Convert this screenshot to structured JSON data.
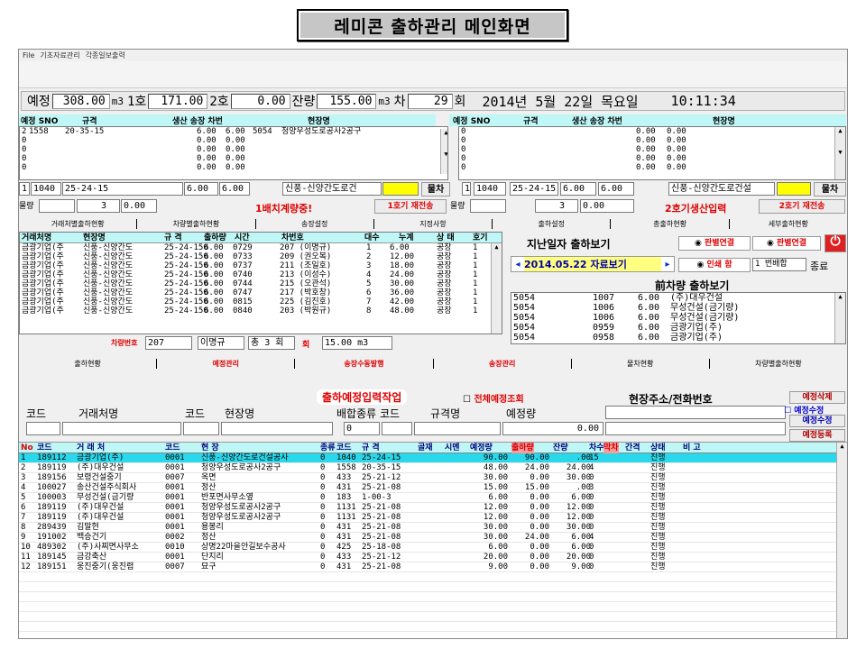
{
  "title": "레미콘 출하관리 메인화면",
  "menu": [
    "File",
    "기초자료관리",
    "각종일보출력"
  ],
  "summary": {
    "plan_label": "예정",
    "plan_value": "308.00",
    "plan_unit": "m3",
    "unit1_label": "1호",
    "unit1_value": "171.00",
    "unit2_label": "2호",
    "unit2_value": "0.00",
    "remain_label": "잔량",
    "remain_value": "155.00",
    "remain_unit": "m3",
    "car_label": "차",
    "car_value": "29",
    "car_unit": "회",
    "date_text": "2014년   5월  22일  목요일",
    "time_text": "10:11:34"
  },
  "left_panel": {
    "headers": [
      "예정 SNO",
      "규격",
      "생산 송장 차번",
      "현장명"
    ],
    "rows": [
      {
        "a": "2",
        "b": "1558",
        "c": "20-35-15",
        "d": "6.00",
        "e": "6.00",
        "f": "5054",
        "g": "청양우성도로공사2공구"
      },
      {
        "a": "0",
        "b": "",
        "c": "",
        "d": "0.00",
        "e": "0.00",
        "f": "",
        "g": ""
      },
      {
        "a": "0",
        "b": "",
        "c": "",
        "d": "0.00",
        "e": "0.00",
        "f": "",
        "g": ""
      },
      {
        "a": "0",
        "b": "",
        "c": "",
        "d": "0.00",
        "e": "0.00",
        "f": "",
        "g": ""
      },
      {
        "a": "0",
        "b": "",
        "c": "",
        "d": "0.00",
        "e": "0.00",
        "f": "",
        "g": ""
      }
    ],
    "current": {
      "no": "1",
      "sno": "1040",
      "spec": "25-24-15",
      "v1": "6.00",
      "v2": "6.00",
      "site": "신풍-신양간도로건"
    },
    "mulcha": "물차",
    "mulryang": "물량",
    "qty": "3",
    "qty_val": "0.00",
    "alert": "1배치계량중!",
    "resend": "1호기 재전송"
  },
  "right_panel": {
    "headers": [
      "예정 SNO",
      "규격",
      "생산 송장 차번",
      "현장명"
    ],
    "rows": [
      {
        "a": "0",
        "d": "0.00",
        "e": "0.00"
      },
      {
        "a": "0",
        "d": "0.00",
        "e": "0.00"
      },
      {
        "a": "0",
        "d": "0.00",
        "e": "0.00"
      },
      {
        "a": "0",
        "d": "0.00",
        "e": "0.00"
      },
      {
        "a": "0",
        "d": "0.00",
        "e": "0.00"
      }
    ],
    "current": {
      "no": "1",
      "sno": "1040",
      "spec": "25-24-15",
      "v1": "6.00",
      "v2": "6.00",
      "site": "신풍-신양간도로건설"
    },
    "mulcha": "물차",
    "mulryang": "물량",
    "qty": "3",
    "qty_val": "0.00",
    "alert": "2호기생산입력",
    "resend": "2호기 재전송"
  },
  "tabs_top": [
    "거래처별출하현황",
    "차량별출하현황",
    "송장설정",
    "지정사항",
    "출하설정",
    "총출하현황",
    "세부출하현황"
  ],
  "ship_grid": {
    "headers": [
      "거래처명",
      "현장명",
      "규 격",
      "출하량",
      "시간",
      "차번호",
      "대수",
      "누계",
      "상 태",
      "호기"
    ],
    "rows": [
      [
        "금광기업(주",
        "신풍-신양간도",
        "25-24-150",
        "6.00",
        "0729",
        "207 (이명규)",
        "1",
        "6.00",
        "공장",
        "1"
      ],
      [
        "금광기업(주",
        "신풍-신양간도",
        "25-24-150",
        "6.00",
        "0733",
        "209 (권오복)",
        "2",
        "12.00",
        "공장",
        "1"
      ],
      [
        "금광기업(주",
        "신풍-신양간도",
        "25-24-150",
        "6.00",
        "0737",
        "211 (조일호)",
        "3",
        "18.00",
        "공장",
        "1"
      ],
      [
        "금광기업(주",
        "신풍-신양간도",
        "25-24-150",
        "6.00",
        "0740",
        "213 (이성수)",
        "4",
        "24.00",
        "공장",
        "1"
      ],
      [
        "금광기업(주",
        "신풍-신양간도",
        "25-24-150",
        "6.00",
        "0744",
        "215 (오관석)",
        "5",
        "30.00",
        "공장",
        "1"
      ],
      [
        "금광기업(주",
        "신풍-신양간도",
        "25-24-150",
        "6.00",
        "0747",
        "217 (박호창)",
        "6",
        "36.00",
        "공장",
        "1"
      ],
      [
        "금광기업(주",
        "신풍-신양간도",
        "25-24-150",
        "6.00",
        "0815",
        "225 (김진호)",
        "7",
        "42.00",
        "공장",
        "1"
      ],
      [
        "금광기업(주",
        "신풍-신양간도",
        "25-24-150",
        "6.00",
        "0840",
        "203 (박원규)",
        "8",
        "48.00",
        "공장",
        "1"
      ]
    ],
    "footer_label": "차량번호",
    "footer_car": "207",
    "footer_name": "이명규",
    "footer_total": "총 3 회",
    "footer_hoe": "회",
    "footer_m3": "15.00 m3"
  },
  "history": {
    "title": "지난일자 출하보기",
    "opt1": "판별연결",
    "opt2": "판별연결",
    "date_btn": "2014.05.22 자료보기",
    "print": "인쇄 함",
    "combo": "1 번배합",
    "end": "종료",
    "prev_title": "前차량 출하보기",
    "rows": [
      [
        "5054",
        "1007",
        "6.00",
        "(주)대우건설"
      ],
      [
        "5054",
        "1006",
        "6.00",
        "무성건설(금기량)"
      ],
      [
        "5054",
        "1006",
        "6.00",
        "무성건설(금기량)"
      ],
      [
        "5054",
        "0959",
        "6.00",
        "금광기업(주)"
      ],
      [
        "5054",
        "0958",
        "6.00",
        "금광기업(주)"
      ]
    ]
  },
  "tabs_mid": [
    "출하현황",
    "예정관리",
    "송장수동발행",
    "송장관리",
    "물차현황",
    "차량별출하현황"
  ],
  "entry": {
    "title": "출하예정입력작업",
    "all_view": "전체예정조회",
    "addr": "현장주소/전화번호",
    "labels": [
      "코드",
      "거래처명",
      "코드",
      "현장명",
      "배합종류 코드",
      "규격명",
      "예정량"
    ],
    "mix_val": "0",
    "qty_val": "0.00",
    "btn_del": "예정삭제",
    "btn_mod": "예정수정",
    "btn_mod2": "예정수정",
    "btn_reg": "예정등록"
  },
  "plan_grid": {
    "headers": [
      "No",
      "코드",
      "거 래 처",
      "코드",
      "현 장",
      "종류",
      "코드",
      "규 격",
      "골재",
      "시멘",
      "예정량",
      "출하량",
      "잔량",
      "차수",
      "막차",
      "간격",
      "상태",
      "비 고"
    ],
    "rows": [
      [
        "1",
        "189112",
        "금광기업(주)",
        "0001",
        "신풍-신양간도로건설공사",
        "0",
        "1040",
        "25-24-15",
        "",
        "",
        "90.00",
        "90.00",
        ".00",
        "15",
        "",
        "",
        "진행",
        ""
      ],
      [
        "2",
        "189119",
        "(주)대우건설",
        "0001",
        "청양우성도로공사2공구",
        "0",
        "1558",
        "20-35-15",
        "",
        "",
        "48.00",
        "24.00",
        "24.00",
        "4",
        "",
        "",
        "진행",
        ""
      ],
      [
        "3",
        "189156",
        "보령건설중기",
        "0007",
        "옥면",
        "0",
        "433",
        "25-21-12",
        "",
        "",
        "30.00",
        "0.00",
        "30.00",
        "0",
        "",
        "",
        "진행",
        ""
      ],
      [
        "4",
        "100027",
        "송산건설주식회사",
        "0001",
        "정산",
        "0",
        "431",
        "25-21-08",
        "",
        "",
        "15.00",
        "15.00",
        ".00",
        "3",
        "",
        "",
        "진행",
        ""
      ],
      [
        "5",
        "100003",
        "무성건설(금기량",
        "0001",
        "반포면사무소옆",
        "0",
        "183",
        "1-00-3",
        "",
        "",
        "6.00",
        "0.00",
        "6.00",
        "0",
        "",
        "",
        "진행",
        ""
      ],
      [
        "6",
        "189119",
        "(주)대우건설",
        "0001",
        "청양우성도로공사2공구",
        "0",
        "1131",
        "25-21-08",
        "",
        "",
        "12.00",
        "0.00",
        "12.00",
        "0",
        "",
        "",
        "진행",
        ""
      ],
      [
        "7",
        "189119",
        "(주)대우건설",
        "0001",
        "청양우성도로공사2공구",
        "0",
        "1131",
        "25-21-08",
        "",
        "",
        "12.00",
        "0.00",
        "12.00",
        "0",
        "",
        "",
        "진행",
        ""
      ],
      [
        "8",
        "289439",
        "김말현",
        "0001",
        "용봉리",
        "0",
        "431",
        "25-21-08",
        "",
        "",
        "30.00",
        "0.00",
        "30.00",
        "0",
        "",
        "",
        "진행",
        ""
      ],
      [
        "9",
        "191002",
        "백승건기",
        "0002",
        "정산",
        "0",
        "431",
        "25-21-08",
        "",
        "",
        "30.00",
        "24.00",
        "6.00",
        "4",
        "",
        "",
        "진행",
        ""
      ],
      [
        "10",
        "489302",
        "(주)사찌면사무소",
        "0010",
        "상명22마을안길보수공사",
        "0",
        "425",
        "25-18-08",
        "",
        "",
        "6.00",
        "0.00",
        "6.00",
        "0",
        "",
        "",
        "진행",
        ""
      ],
      [
        "11",
        "189145",
        "금강축산",
        "0001",
        "단지리",
        "0",
        "433",
        "25-21-12",
        "",
        "",
        "20.00",
        "0.00",
        "20.00",
        "0",
        "",
        "",
        "진행",
        ""
      ],
      [
        "12",
        "189151",
        "웅진중기(웅진렴",
        "0007",
        "묘구",
        "0",
        "431",
        "25-21-08",
        "",
        "",
        "9.00",
        "0.00",
        "9.00",
        "0",
        "",
        "",
        "진행",
        ""
      ]
    ]
  }
}
